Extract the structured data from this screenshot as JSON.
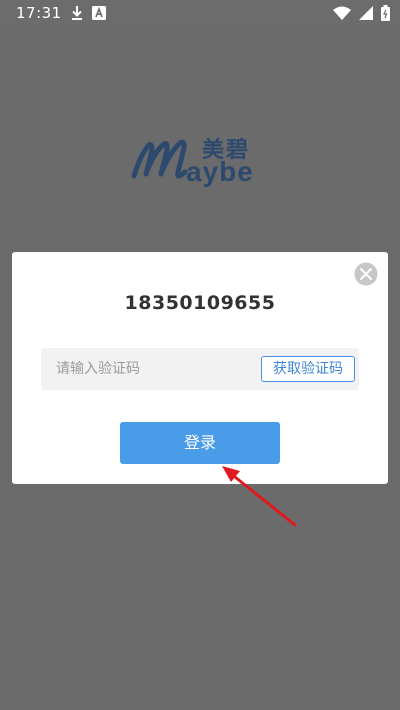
{
  "status_bar": {
    "time": "17:31",
    "left_icons": [
      "download-icon",
      "a-notification-icon"
    ],
    "right_icons": [
      "wifi-icon",
      "signal-icon",
      "battery-icon"
    ]
  },
  "app": {
    "logo_cn": "美碧",
    "logo_en": "aybe"
  },
  "dialog": {
    "phone_number": "18350109655",
    "code_input": {
      "value": "",
      "placeholder": "请输入验证码"
    },
    "get_code_label": "获取验证码",
    "login_label": "登录"
  },
  "colors": {
    "overlay": "#6c6c6c",
    "accent": "#4a9be8",
    "annotation": "#e0191e"
  }
}
